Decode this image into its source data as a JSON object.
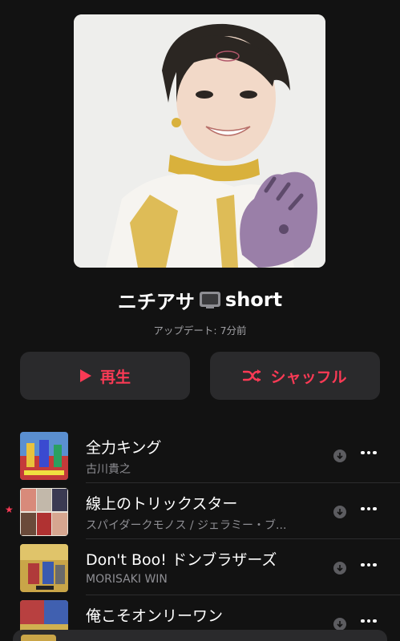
{
  "playlist": {
    "title": "ニチアサ",
    "title_suffix": "short",
    "updated": "アップデート: 7分前",
    "tv_icon": "tv-icon"
  },
  "actions": {
    "play_label": "再生",
    "shuffle_label": "シャッフル",
    "accent_color": "#fb3a55"
  },
  "tracks": [
    {
      "title": "全力キング",
      "artist": "古川貴之",
      "downloaded": true,
      "favorite": false
    },
    {
      "title": "線上のトリックスター",
      "artist": "スパイダークモノス / ジェラミー・ブ...",
      "downloaded": true,
      "favorite": true
    },
    {
      "title": "Don't Boo! ドンブラザーズ",
      "artist": "MORISAKI WIN",
      "downloaded": true,
      "favorite": false
    },
    {
      "title": "俺こそオンリーワン",
      "artist": "",
      "downloaded": true,
      "favorite": false
    }
  ]
}
